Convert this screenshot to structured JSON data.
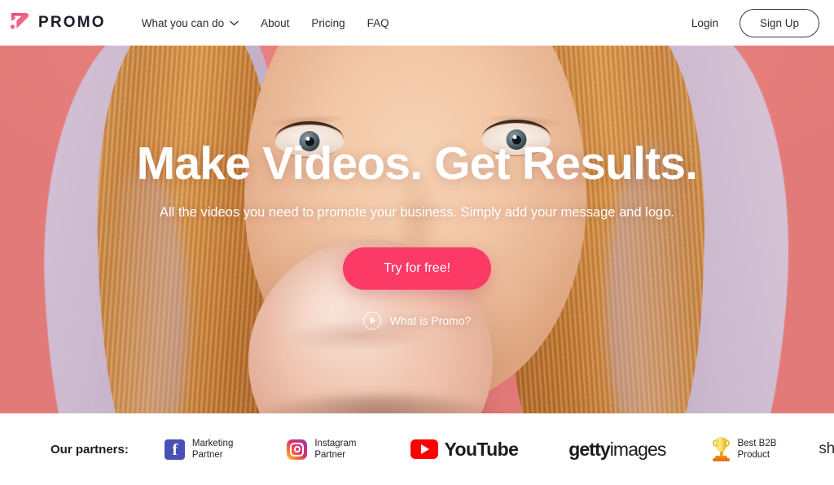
{
  "brand": {
    "name": "PROMO",
    "logo_icon": "promo-play-logo",
    "accent_color": "#fb3a66",
    "logo_gradient_from": "#e8456f",
    "logo_gradient_to": "#f06a8a"
  },
  "header": {
    "nav": [
      {
        "label": "What you can do",
        "has_dropdown": true,
        "icon": "chevron-down-icon"
      },
      {
        "label": "About",
        "has_dropdown": false
      },
      {
        "label": "Pricing",
        "has_dropdown": false
      },
      {
        "label": "FAQ",
        "has_dropdown": false
      }
    ],
    "login_label": "Login",
    "signup_label": "Sign Up"
  },
  "hero": {
    "title": "Make Videos. Get Results.",
    "subtitle": "All the videos you need to promote your business. Simply add your message and logo.",
    "cta_label": "Try for free!",
    "cta_color": "#fb3a66",
    "video_link_label": "What is Promo?",
    "video_link_icon": "play-circle-icon",
    "background_color": "#e8807f",
    "image_description": "woman blowing a bubble gum bubble wearing a lavender hood on a coral background"
  },
  "partners": {
    "label": "Our partners:",
    "items": [
      {
        "name": "facebook",
        "icon": "facebook-icon",
        "line1": "Marketing",
        "line2": "Partner",
        "color": "#4a51b5"
      },
      {
        "name": "instagram",
        "icon": "instagram-icon",
        "line1": "Instagram",
        "line2": "Partner",
        "color": "#e1306c"
      },
      {
        "name": "youtube",
        "icon": "youtube-icon",
        "wordmark": "YouTube",
        "color": "#ff0000"
      },
      {
        "name": "gettyimages",
        "icon": "gettyimages-wordmark",
        "word_bold": "getty",
        "word_light": "images",
        "color": "#1b1b1b"
      },
      {
        "name": "best-b2b-product",
        "icon": "trophy-icon",
        "line1": "Best B2B",
        "line2": "Product",
        "color": "#f2cf3e"
      },
      {
        "name": "shutterstock",
        "icon": "shutterstock-wordmark",
        "wordmark": "shutterstock",
        "registered": "®",
        "color": "#2e2e34"
      }
    ]
  }
}
